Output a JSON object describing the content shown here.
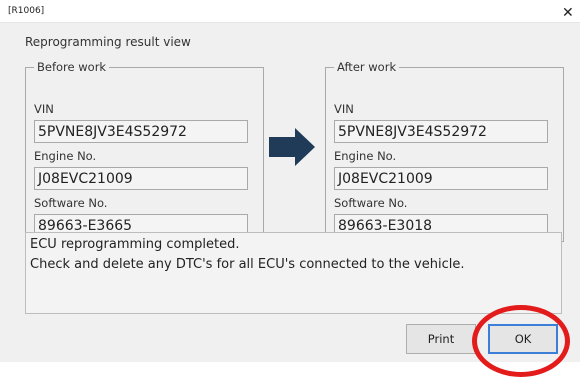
{
  "window": {
    "title": "[R1006]",
    "close_glyph": "✕"
  },
  "header": {
    "title": "Reprogramming result view"
  },
  "before": {
    "legend": "Before work",
    "vin_label": "VIN",
    "vin": "5PVNE8JV3E4S52972",
    "engine_label": "Engine No.",
    "engine": "J08EVC21009",
    "software_label": "Software No.",
    "software": "89663-E3665"
  },
  "after": {
    "legend": "After work",
    "vin_label": "VIN",
    "vin": "5PVNE8JV3E4S52972",
    "engine_label": "Engine No.",
    "engine": "J08EVC21009",
    "software_label": "Software No.",
    "software": "89663-E3018"
  },
  "message": {
    "line1": "ECU reprogramming completed.",
    "line2": "Check and delete any DTC's for all ECU's connected to the vehicle."
  },
  "buttons": {
    "print": "Print",
    "ok": "OK"
  },
  "colors": {
    "arrow": "#1f3b57",
    "highlight": "#e41b1b",
    "ok_border": "#3d7fd6"
  },
  "icons": {
    "arrow": "right-arrow-icon",
    "close": "close-icon"
  }
}
